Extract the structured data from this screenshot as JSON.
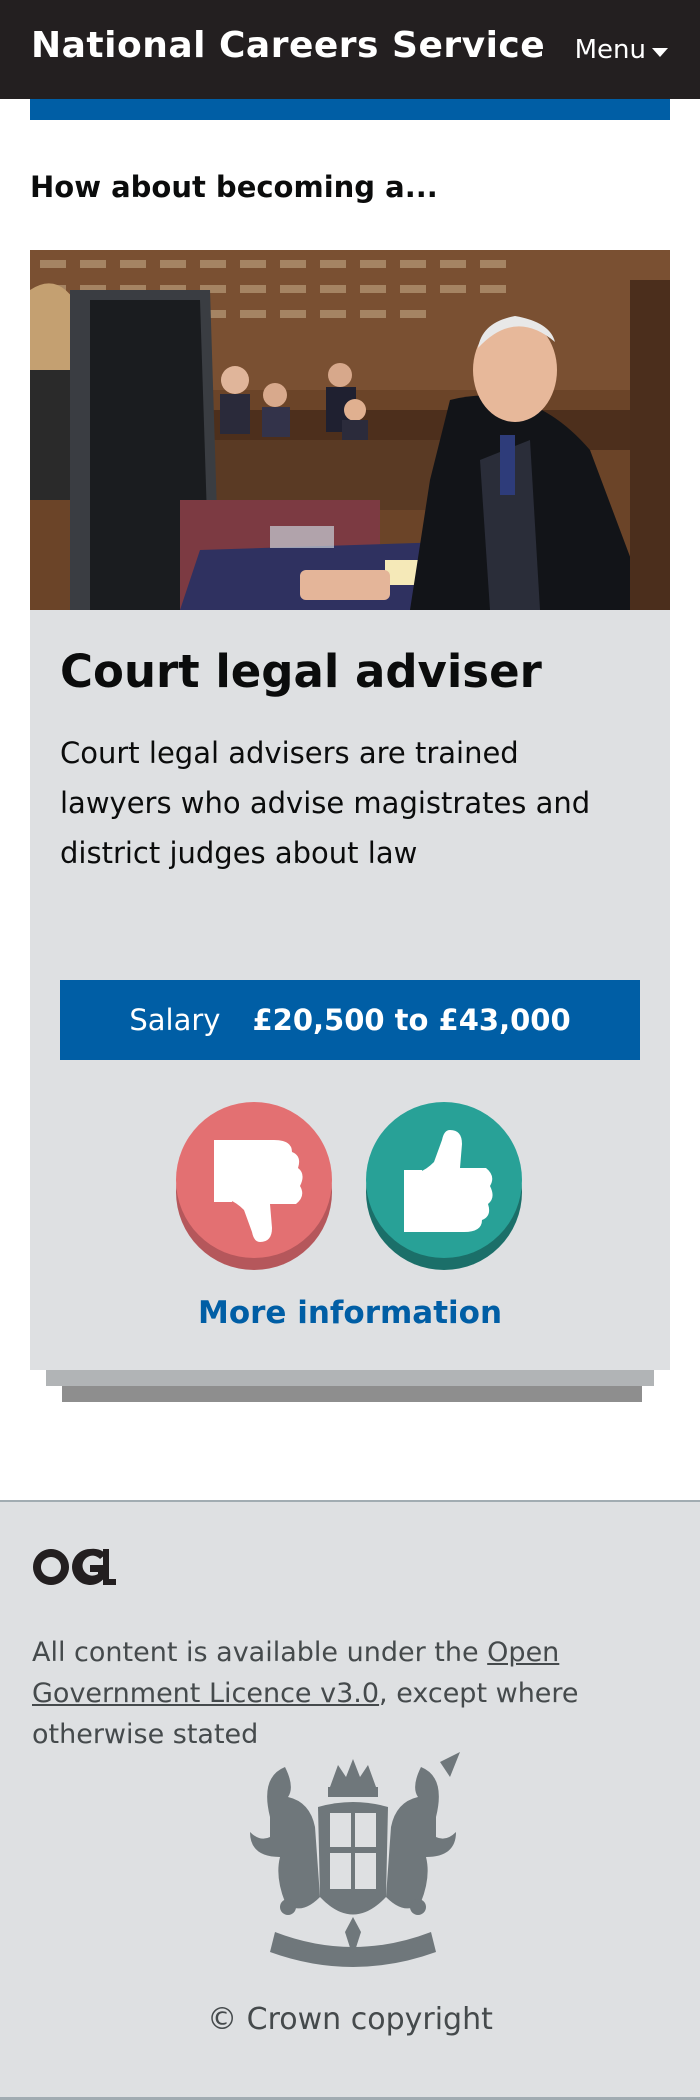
{
  "header": {
    "brand": "National Careers Service",
    "menu_label": "Menu"
  },
  "intro": "How about becoming a...",
  "card": {
    "title": "Court legal adviser",
    "description": "Court legal advisers are trained lawyers who advise magistrates and district judges about law",
    "salary_label": "Salary",
    "salary_value": "£20,500 to £43,000",
    "more_info": "More information",
    "dislike_color": "#e37072",
    "like_color": "#28a197"
  },
  "footer": {
    "licence_prefix": "All content is available under the ",
    "licence_link": "Open Government Licence v3.0",
    "licence_suffix": ", except where otherwise stated",
    "copyright": "© Crown copyright"
  },
  "colors": {
    "header": "#231f20",
    "brand_blue": "#005ea5",
    "card_bg": "#dee0e2"
  }
}
